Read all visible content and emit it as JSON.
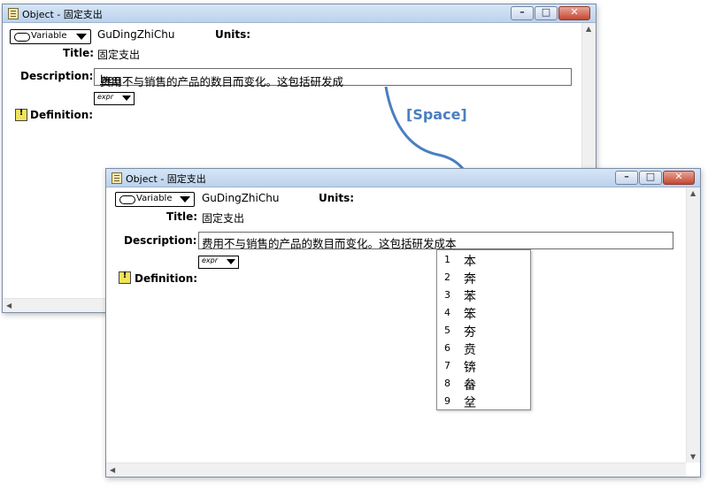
{
  "window_back": {
    "title": "Object - 固定支出",
    "identifier": "GuDingZhiChu",
    "class_label": "Variable",
    "units_label": "Units:",
    "title_label": "Title:",
    "title_value": "固定支出",
    "description_label": "Description:",
    "description_text": "费用不与销售的产品的数目而变化。这包括研发成",
    "composing_text": "ben",
    "expr_label": "expr",
    "definition_label": "Definition:"
  },
  "window_front": {
    "title": "Object - 固定支出",
    "identifier": "GuDingZhiChu",
    "class_label": "Variable",
    "units_label": "Units:",
    "title_label": "Title:",
    "title_value": "固定支出",
    "description_label": "Description:",
    "description_text": "费用不与销售的产品的数目而变化。这包括研发成本",
    "expr_label": "expr",
    "definition_label": "Definition:"
  },
  "annotation": {
    "key_label": "[Space]",
    "color": "#4a7fc0"
  },
  "ime_candidates": [
    {
      "num": "1",
      "char": "本"
    },
    {
      "num": "2",
      "char": "奔"
    },
    {
      "num": "3",
      "char": "苯"
    },
    {
      "num": "4",
      "char": "笨"
    },
    {
      "num": "5",
      "char": "夯"
    },
    {
      "num": "6",
      "char": "贲"
    },
    {
      "num": "7",
      "char": "锛"
    },
    {
      "num": "8",
      "char": "畚"
    },
    {
      "num": "9",
      "char": "坌"
    }
  ],
  "icons": {
    "window": "object-window-icon",
    "minimize": "minimize-icon",
    "maximize": "maximize-icon",
    "close": "close-icon",
    "warning": "warning-icon"
  }
}
